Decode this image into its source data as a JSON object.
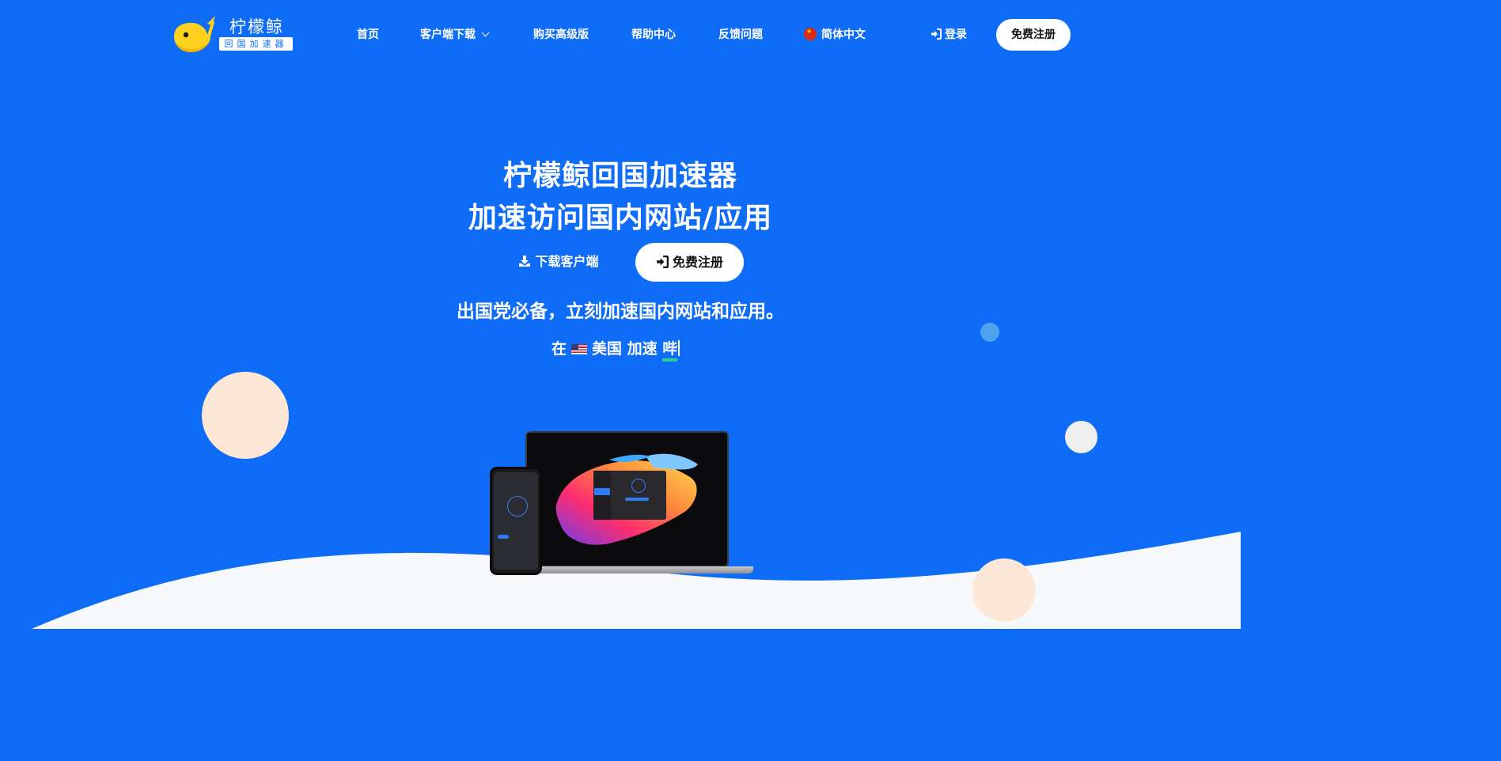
{
  "brand": {
    "name": "柠檬鲸",
    "tagline": "回国加速器"
  },
  "nav": {
    "home": "首页",
    "download": "客户端下载",
    "buy": "购买高级版",
    "help": "帮助中心",
    "feedback": "反馈问题",
    "language": "简体中文",
    "login": "登录",
    "register": "免费注册"
  },
  "hero": {
    "title_line1": "柠檬鲸回国加速器",
    "title_line2": "加速访问国内网站/应用",
    "download_button": "下载客户端",
    "register_button": "免费注册",
    "slogan": "出国党必备，立刻加速国内网站和应用。",
    "typing": {
      "prefix": "在",
      "country": "美国",
      "action": "加速",
      "target": "哔"
    }
  },
  "icons": {
    "language_flag": "china-flag-icon",
    "login": "sign-in-icon",
    "download": "download-icon",
    "country_flag": "us-flag-icon",
    "dropdown": "chevron-down-icon"
  },
  "colors": {
    "background": "#0e6cf7",
    "button_bg": "#ffffff",
    "underline": "#2bd18b",
    "peach": "#fde8d8"
  }
}
